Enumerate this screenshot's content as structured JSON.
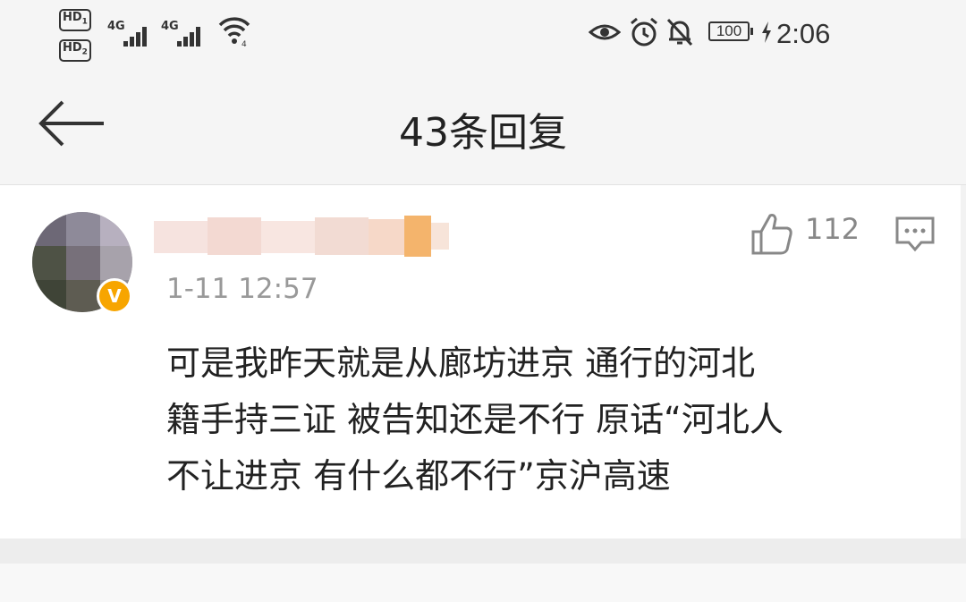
{
  "status_bar": {
    "sim1": "HD",
    "sim1_index": "1",
    "sim2": "HD",
    "sim2_index": "2",
    "network1": "4G",
    "network2": "4G",
    "battery": "100",
    "time": "2:06",
    "icons": [
      "eye-icon",
      "alarm-icon",
      "mute-bell-icon",
      "charging-icon"
    ]
  },
  "header": {
    "title": "43条回复"
  },
  "comment": {
    "timestamp": "1-11 12:57",
    "verified_badge": "V",
    "like_count": "112",
    "content_lines": [
      "可是我昨天就是从廊坊进京 通行的河北",
      "籍手持三证 被告知还是不行 原话“河北人",
      "不让进京 有什么都不行”京沪高速"
    ]
  },
  "colors": {
    "badge": "#f7a500",
    "text": "#222222",
    "muted": "#999999"
  }
}
